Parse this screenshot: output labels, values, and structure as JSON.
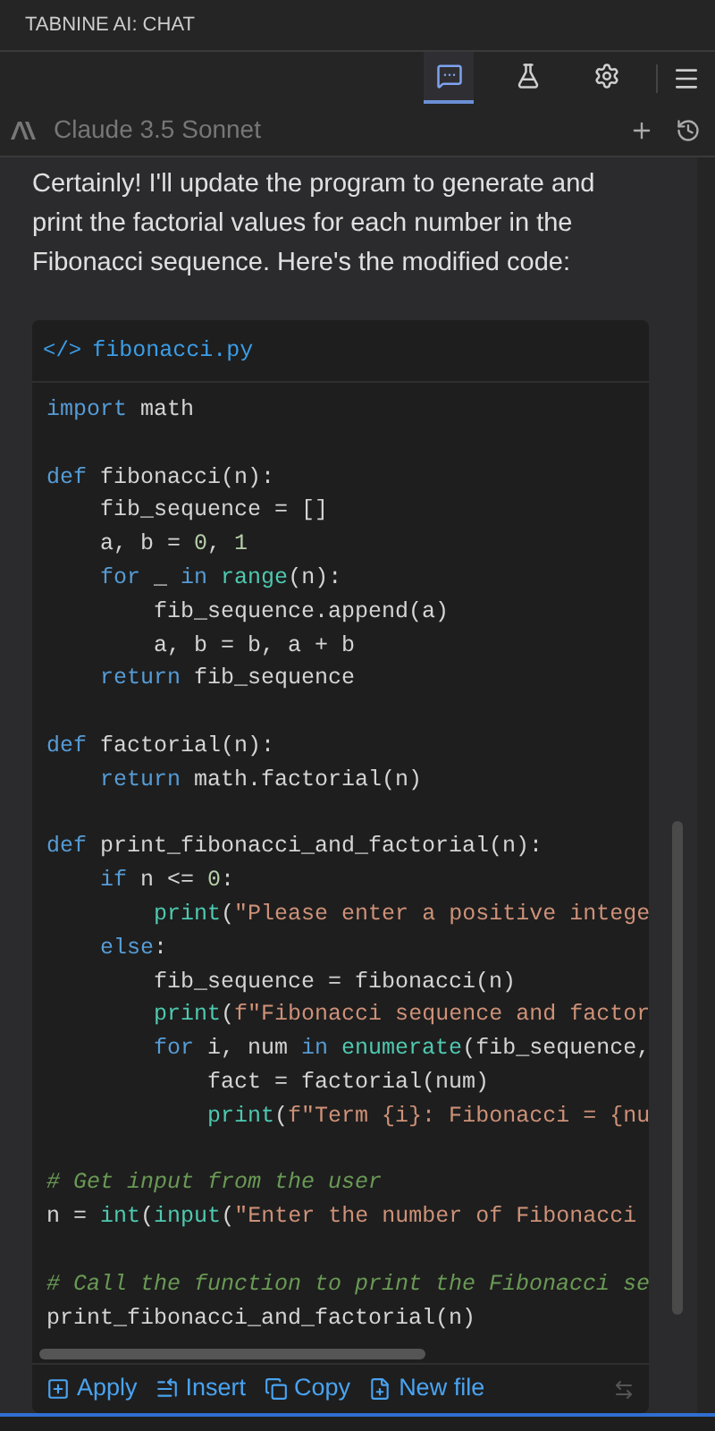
{
  "panel_title": "TABNINE AI: CHAT",
  "toolbar": [
    {
      "kind": "chat",
      "selected": true
    },
    {
      "kind": "test",
      "selected": false
    },
    {
      "kind": "settings",
      "selected": false
    }
  ],
  "model": {
    "name": "Claude 3.5 Sonnet"
  },
  "message": "Certainly! I'll update the program to generate and print the factorial values for each number in the Fibonacci sequence. Here's the modified code:",
  "code_block": {
    "icon": "</>",
    "filename": "fibonacci.py",
    "lines": [
      {
        "kind": "code",
        "tokens": [
          {
            "text": "import ",
            "kind": "keyword"
          },
          {
            "text": "math",
            "kind": "plain"
          }
        ]
      },
      {
        "kind": "blank"
      },
      {
        "kind": "code",
        "tokens": [
          {
            "text": "def ",
            "kind": "keyword"
          },
          {
            "text": "fibonacci(n):",
            "kind": "plain"
          }
        ]
      },
      {
        "kind": "code",
        "tokens": [
          {
            "text": "    fib_sequence = []",
            "kind": "plain"
          }
        ]
      },
      {
        "kind": "code",
        "tokens": [
          {
            "text": "    a, b = ",
            "kind": "plain"
          },
          {
            "text": "0",
            "kind": "number"
          },
          {
            "text": ", ",
            "kind": "plain"
          },
          {
            "text": "1",
            "kind": "number"
          }
        ]
      },
      {
        "kind": "code",
        "tokens": [
          {
            "text": "    for",
            "kind": "keyword"
          },
          {
            "text": " _ ",
            "kind": "plain"
          },
          {
            "text": "in ",
            "kind": "keyword"
          },
          {
            "text": "range",
            "kind": "builtin"
          },
          {
            "text": "(n):",
            "kind": "plain"
          }
        ]
      },
      {
        "kind": "code",
        "tokens": [
          {
            "text": "        fib_sequence.append(a)",
            "kind": "plain"
          }
        ]
      },
      {
        "kind": "code",
        "tokens": [
          {
            "text": "        a, b = b, a + b",
            "kind": "plain"
          }
        ]
      },
      {
        "kind": "code",
        "tokens": [
          {
            "text": "    return ",
            "kind": "keyword"
          },
          {
            "text": "fib_sequence",
            "kind": "plain"
          }
        ]
      },
      {
        "kind": "blank"
      },
      {
        "kind": "code",
        "tokens": [
          {
            "text": "def ",
            "kind": "keyword"
          },
          {
            "text": "factorial(n):",
            "kind": "plain"
          }
        ]
      },
      {
        "kind": "code",
        "tokens": [
          {
            "text": "    return ",
            "kind": "keyword"
          },
          {
            "text": "math.factorial(n)",
            "kind": "plain"
          }
        ]
      },
      {
        "kind": "blank"
      },
      {
        "kind": "code",
        "tokens": [
          {
            "text": "def ",
            "kind": "keyword"
          },
          {
            "text": "print_fibonacci_and_factorial(n):",
            "kind": "plain"
          }
        ]
      },
      {
        "kind": "code",
        "tokens": [
          {
            "text": "    if",
            "kind": "keyword"
          },
          {
            "text": " n <= ",
            "kind": "plain"
          },
          {
            "text": "0",
            "kind": "number"
          },
          {
            "text": ":",
            "kind": "plain"
          }
        ]
      },
      {
        "kind": "code",
        "tokens": [
          {
            "text": "        print",
            "kind": "builtin"
          },
          {
            "text": "(",
            "kind": "plain"
          },
          {
            "text": "\"Please enter a positive intege",
            "kind": "string"
          }
        ]
      },
      {
        "kind": "code",
        "tokens": [
          {
            "text": "    else",
            "kind": "keyword"
          },
          {
            "text": ":",
            "kind": "plain"
          }
        ]
      },
      {
        "kind": "code",
        "tokens": [
          {
            "text": "        fib_sequence = fibonacci(n)",
            "kind": "plain"
          }
        ]
      },
      {
        "kind": "code",
        "tokens": [
          {
            "text": "        print",
            "kind": "builtin"
          },
          {
            "text": "(",
            "kind": "plain"
          },
          {
            "text": "f\"Fibonacci sequence and factor",
            "kind": "string"
          }
        ]
      },
      {
        "kind": "code",
        "tokens": [
          {
            "text": "        for",
            "kind": "keyword"
          },
          {
            "text": " i, num ",
            "kind": "plain"
          },
          {
            "text": "in ",
            "kind": "keyword"
          },
          {
            "text": "enumerate",
            "kind": "builtin"
          },
          {
            "text": "(fib_sequence,",
            "kind": "plain"
          }
        ]
      },
      {
        "kind": "code",
        "tokens": [
          {
            "text": "            fact = factorial(num)",
            "kind": "plain"
          }
        ]
      },
      {
        "kind": "code",
        "tokens": [
          {
            "text": "            print",
            "kind": "builtin"
          },
          {
            "text": "(",
            "kind": "plain"
          },
          {
            "text": "f\"Term {i}: Fibonacci = {nu",
            "kind": "string"
          }
        ]
      },
      {
        "kind": "blank"
      },
      {
        "kind": "code",
        "tokens": [
          {
            "text": "# Get input from the user",
            "kind": "comment"
          }
        ]
      },
      {
        "kind": "code",
        "tokens": [
          {
            "text": "n = ",
            "kind": "plain"
          },
          {
            "text": "int",
            "kind": "builtin"
          },
          {
            "text": "(",
            "kind": "plain"
          },
          {
            "text": "input",
            "kind": "builtin"
          },
          {
            "text": "(",
            "kind": "plain"
          },
          {
            "text": "\"Enter the number of Fibonacci",
            "kind": "string"
          }
        ]
      },
      {
        "kind": "blank"
      },
      {
        "kind": "code",
        "tokens": [
          {
            "text": "# Call the function to print the Fibonacci se",
            "kind": "comment"
          }
        ]
      },
      {
        "kind": "code",
        "tokens": [
          {
            "text": "print_fibonacci_and_factorial(n)",
            "kind": "plain"
          }
        ]
      }
    ],
    "actions": [
      {
        "kind": "apply",
        "label": "Apply"
      },
      {
        "kind": "insert",
        "label": "Insert"
      },
      {
        "kind": "copy",
        "label": "Copy"
      },
      {
        "kind": "new_file",
        "label": "New file"
      }
    ],
    "diff_disabled": true
  }
}
